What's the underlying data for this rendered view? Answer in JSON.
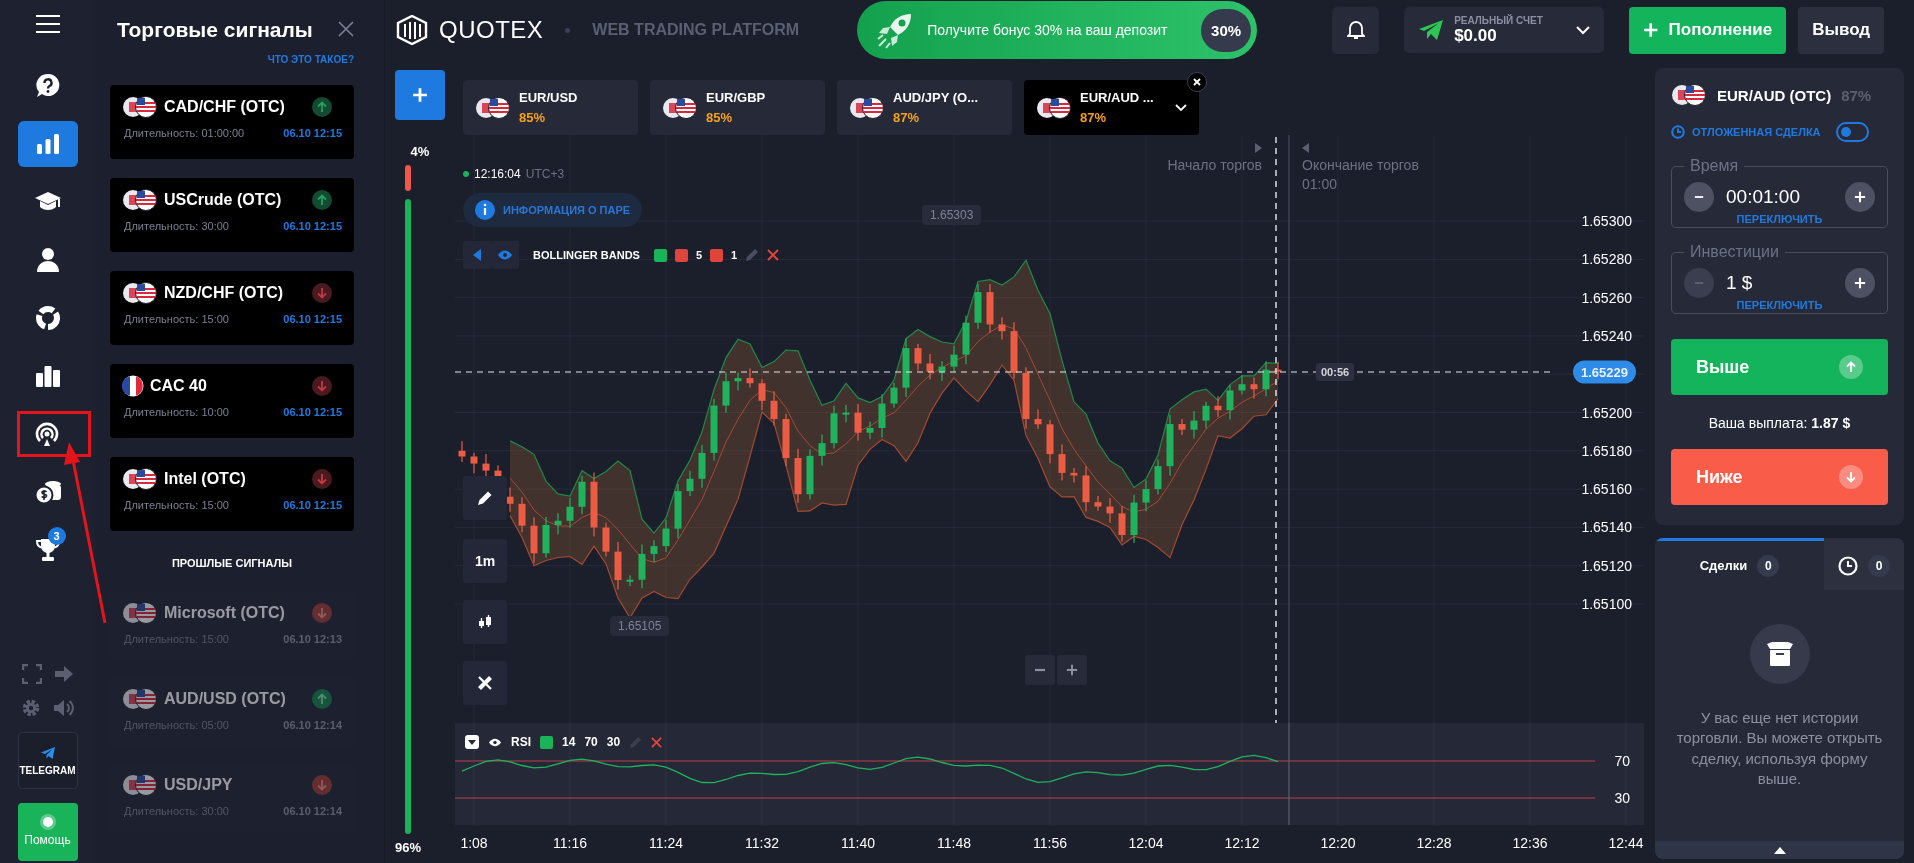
{
  "sidebar": {
    "items": [
      {
        "selected": false,
        "highlighted": false
      },
      {
        "selected": true,
        "highlighted": false
      },
      {
        "selected": false,
        "highlighted": false
      },
      {
        "selected": false,
        "highlighted": false
      },
      {
        "selected": false,
        "highlighted": false
      },
      {
        "selected": false,
        "highlighted": false
      },
      {
        "selected": false,
        "highlighted": true
      },
      {
        "selected": false,
        "highlighted": false
      },
      {
        "selected": false,
        "highlighted": false,
        "badge": "3"
      }
    ],
    "telegram": "TELEGRAM",
    "help": "Помощь"
  },
  "signals": {
    "title": "Торговые сигналы",
    "link": "ЧТО ЭТО ТАКОЕ?",
    "active": [
      {
        "kind": "pair",
        "asset": "CAD/CHF (OTC)",
        "duration": "Длительность: 01:00:00",
        "time": "06.10 12:15",
        "rising": true
      },
      {
        "kind": "pair",
        "asset": "USCrude (OTC)",
        "duration": "Длительность: 30:00",
        "time": "06.10 12:15",
        "rising": true
      },
      {
        "kind": "pair",
        "asset": "NZD/CHF (OTC)",
        "duration": "Длительность: 15:00",
        "time": "06.10 12:15",
        "rising": false
      },
      {
        "kind": "single",
        "asset": "CAC 40",
        "duration": "Длительность: 10:00",
        "time": "06.10 12:15",
        "rising": false
      },
      {
        "kind": "pair",
        "asset": "Intel (OTC)",
        "duration": "Длительность: 15:00",
        "time": "06.10 12:15",
        "rising": false
      }
    ],
    "past_heading": "ПРОШЛЫЕ СИГНАЛЫ",
    "past": [
      {
        "kind": "pair",
        "asset": "Microsoft (OTC)",
        "duration": "Длительность: 15:00",
        "time": "06.10 12:13",
        "rising": false
      },
      {
        "kind": "pair",
        "asset": "AUD/USD (OTC)",
        "duration": "Длительность: 05:00",
        "time": "06.10 12:14",
        "rising": true
      },
      {
        "kind": "pair",
        "asset": "USD/JPY",
        "duration": "Длительность: 30:00",
        "time": "06.10 12:14",
        "rising": false
      }
    ]
  },
  "header": {
    "logo": "QUOTEX",
    "subtitle": "WEB TRADING PLATFORM",
    "bonus": {
      "text": "Получите бонус 30% на ваш депозит",
      "badge": "30%"
    },
    "account": {
      "label": "РЕАЛЬНЫЙ СЧЕТ",
      "balance": "$0.00"
    },
    "deposit": "Пополнение",
    "withdraw": "Вывод"
  },
  "asset_tabs": [
    {
      "name": "EUR/USD",
      "payout": "85%",
      "selected": false
    },
    {
      "name": "EUR/GBP",
      "payout": "85%",
      "selected": false
    },
    {
      "name": "AUD/JPY (O...",
      "payout": "87%",
      "selected": false
    },
    {
      "name": "EUR/AUD ...",
      "payout": "87%",
      "selected": true
    }
  ],
  "sentiment": {
    "sell": "4%",
    "buy": "96%",
    "level": 0.96
  },
  "chart": {
    "clock": "12:16:04",
    "timezone": "UTC+3",
    "pair_info": "ИНФОРМАЦИЯ О ПАРЕ",
    "indicator": {
      "name": "BOLLINGER BANDS",
      "params": [
        "5",
        "1"
      ]
    },
    "high_label": "1.65303",
    "low_label": "1.65105",
    "trading_start": "Начало торгов",
    "trading_end": "Окончание торгов",
    "trading_end_time": "01:00",
    "price_ticks": [
      "1.65300",
      "1.65280",
      "1.65260",
      "1.65240",
      "1.65200",
      "1.65180",
      "1.65160",
      "1.65140",
      "1.65120",
      "1.65100"
    ],
    "current_price": "1.65229",
    "countdown": "00:56",
    "timeframe": "1m",
    "time_ticks": [
      "1:08",
      "11:16",
      "11:24",
      "11:32",
      "11:40",
      "11:48",
      "11:56",
      "12:04",
      "12:12",
      "12:20",
      "12:28",
      "12:36",
      "12:44"
    ]
  },
  "rsi": {
    "name": "RSI",
    "params": [
      "14",
      "70",
      "30"
    ],
    "levels": [
      "70",
      "30"
    ]
  },
  "trade": {
    "asset": "EUR/AUD (OTC)",
    "payout": "87%",
    "pending": {
      "label": "ОТЛОЖЕННАЯ СДЕЛКА",
      "on": false
    },
    "time": {
      "label": "Время",
      "value": "00:01:00",
      "switch": "ПЕРЕКЛЮЧИТЬ",
      "minus_disabled": false
    },
    "investment": {
      "label": "Инвестиции",
      "value": "1 $",
      "switch": "ПЕРЕКЛЮЧИТЬ",
      "minus_disabled": true
    },
    "up": "Выше",
    "payout_text": "Ваша выплата: **1.87 $**",
    "down": "Ниже"
  },
  "trades": {
    "tabs": [
      {
        "kind": "label",
        "label": "Сделки",
        "count": "0",
        "selected": true
      },
      {
        "kind": "clock",
        "count": "0",
        "selected": false
      }
    ],
    "empty": "У вас еще нет истории торговли. Вы можете открыть сделку, используя форму выше."
  }
}
